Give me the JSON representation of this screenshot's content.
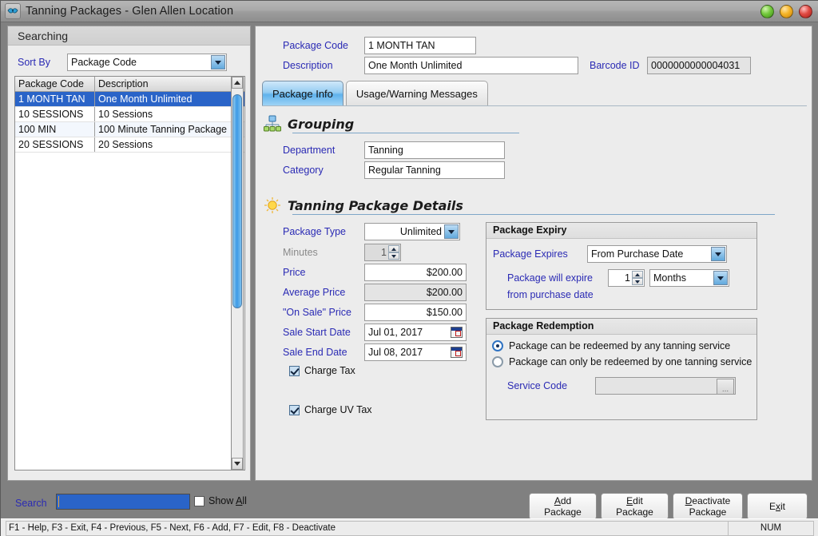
{
  "window": {
    "title": "Tanning Packages - Glen Allen Location",
    "icon": "app-logo-icon",
    "controls": {
      "minimize": "minimize",
      "maximize": "maximize",
      "close": "close"
    }
  },
  "search_panel": {
    "header": "Searching",
    "sort_by_label": "Sort By",
    "sort_by_value": "Package Code",
    "columns": [
      "Package Code",
      "Description"
    ],
    "rows": [
      {
        "code": "1 MONTH TAN",
        "description": "One Month Unlimited",
        "selected": true
      },
      {
        "code": "10 SESSIONS",
        "description": "10 Sessions",
        "selected": false
      },
      {
        "code": "100 MIN",
        "description": "100 Minute Tanning Package",
        "selected": false
      },
      {
        "code": "20 SESSIONS",
        "description": "20 Sessions",
        "selected": false
      }
    ]
  },
  "detail": {
    "package_code_label": "Package Code",
    "package_code_value": "1 MONTH TAN",
    "description_label": "Description",
    "description_value": "One Month Unlimited",
    "barcode_label": "Barcode ID",
    "barcode_value": "0000000000004031",
    "tabs": [
      {
        "label": "Package Info",
        "active": true
      },
      {
        "label": "Usage/Warning Messages",
        "active": false
      }
    ],
    "grouping": {
      "title": "Grouping",
      "icon": "hierarchy-icon",
      "department_label": "Department",
      "department_value": "Tanning",
      "category_label": "Category",
      "category_value": "Regular Tanning"
    },
    "package_details": {
      "title": "Tanning Package Details",
      "icon": "sun-icon",
      "package_type_label": "Package Type",
      "package_type_value": "Unlimited",
      "minutes_label": "Minutes",
      "minutes_value": "1",
      "price_label": "Price",
      "price_value": "$200.00",
      "average_price_label": "Average Price",
      "average_price_value": "$200.00",
      "on_sale_price_label": "\"On Sale\" Price",
      "on_sale_price_value": "$150.00",
      "sale_start_label": "Sale Start Date",
      "sale_start_value": "Jul 01, 2017",
      "sale_end_label": "Sale End Date",
      "sale_end_value": "Jul 08, 2017",
      "charge_tax_label": "Charge Tax",
      "charge_tax_checked": true,
      "charge_uv_tax_label": "Charge UV Tax",
      "charge_uv_tax_checked": true
    },
    "expiry": {
      "title": "Package Expiry",
      "expires_label": "Package Expires",
      "expires_value": "From Purchase Date",
      "will_expire_label": "Package will expire",
      "from_purchase_label": "from purchase date",
      "amount_value": "1",
      "unit_value": "Months"
    },
    "redemption": {
      "title": "Package Redemption",
      "option_any": "Package can be redeemed by any tanning service",
      "option_one": "Package can only be redeemed by one tanning service",
      "selected_option": "any",
      "service_code_label": "Service Code",
      "service_code_value": "",
      "browse_label": "..."
    }
  },
  "bottom": {
    "search_label": "Search",
    "search_value": "",
    "show_all_label_pre": "Show ",
    "show_all_label_key": "A",
    "show_all_label_post": "ll",
    "show_all_checked": false,
    "buttons": [
      {
        "line1_pre": "",
        "line1_key": "A",
        "line1_post": "dd",
        "line2": "Package",
        "name": "add-package-button"
      },
      {
        "line1_pre": "",
        "line1_key": "E",
        "line1_post": "dit",
        "line2": "Package",
        "name": "edit-package-button"
      },
      {
        "line1_pre": "",
        "line1_key": "D",
        "line1_post": "eactivate",
        "line2": "Package",
        "name": "deactivate-package-button"
      },
      {
        "line1_pre": "E",
        "line1_key": "x",
        "line1_post": "it",
        "line2": "",
        "name": "exit-button"
      }
    ]
  },
  "status": {
    "keys": "F1 - Help, F3 - Exit, F4 - Previous, F5 - Next, F6 - Add, F7 - Edit, F8 - Deactivate",
    "num": "NUM"
  }
}
